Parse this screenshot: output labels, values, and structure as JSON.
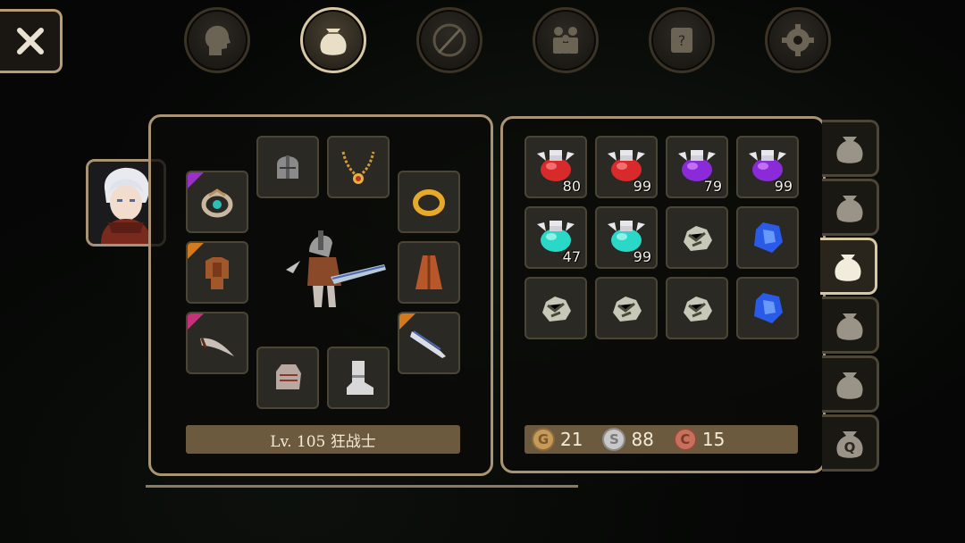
{
  "top_tabs": [
    {
      "icon": "profile-head-icon",
      "active": false
    },
    {
      "icon": "bag-icon",
      "active": true
    },
    {
      "icon": "sword-compass-icon",
      "active": false
    },
    {
      "icon": "party-icon",
      "active": false
    },
    {
      "icon": "quest-scroll-icon",
      "active": false
    },
    {
      "icon": "gear-icon",
      "active": false
    }
  ],
  "character": {
    "level_label": "Lv. 105 狂战士"
  },
  "inventory": {
    "items": [
      {
        "icon": "red-potion-icon",
        "qty": "80"
      },
      {
        "icon": "red-potion-icon",
        "qty": "99"
      },
      {
        "icon": "purple-potion-icon",
        "qty": "79"
      },
      {
        "icon": "purple-potion-icon",
        "qty": "99"
      },
      {
        "icon": "cyan-potion-icon",
        "qty": "47"
      },
      {
        "icon": "cyan-potion-icon",
        "qty": "99"
      },
      {
        "icon": "ore-icon",
        "qty": ""
      },
      {
        "icon": "blue-gem-icon",
        "qty": ""
      },
      {
        "icon": "ore-icon",
        "qty": ""
      },
      {
        "icon": "ore-icon",
        "qty": ""
      },
      {
        "icon": "ore-icon",
        "qty": ""
      },
      {
        "icon": "blue-gem-icon",
        "qty": ""
      }
    ]
  },
  "currency": {
    "gold": {
      "letter": "G",
      "amount": "21"
    },
    "silver": {
      "letter": "S",
      "amount": "88"
    },
    "copper": {
      "letter": "C",
      "amount": "15"
    }
  },
  "side_tabs": [
    {
      "icon": "bag-icon",
      "active": false
    },
    {
      "icon": "bag-icon",
      "active": false
    },
    {
      "icon": "bag-icon",
      "active": true
    },
    {
      "icon": "bag-icon",
      "active": false
    },
    {
      "icon": "bag-icon",
      "active": false
    },
    {
      "icon": "quest-bag-icon",
      "letter": "Q",
      "active": false
    }
  ],
  "colors": {
    "frame": "#a89474",
    "bar": "#6b5a3d",
    "rarity_purple": "#9a30c8",
    "rarity_orange": "#d27a1c",
    "rarity_pink": "#c8307a"
  }
}
